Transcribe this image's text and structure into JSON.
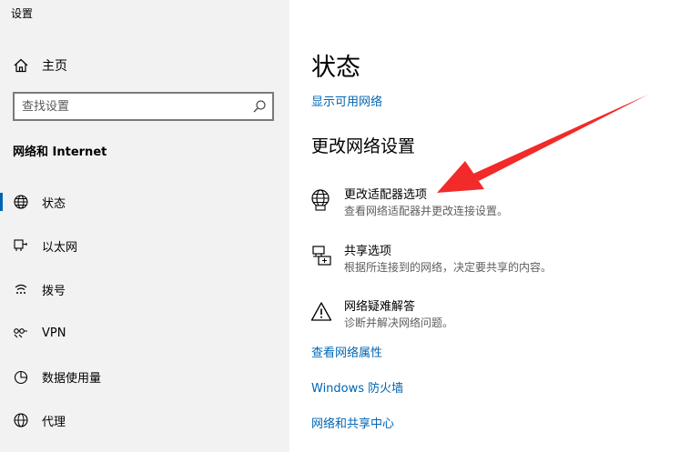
{
  "window": {
    "title": "设置"
  },
  "sidebar": {
    "home_label": "主页",
    "search_placeholder": "查找设置",
    "section_title": "网络和 Internet",
    "items": [
      {
        "label": "状态",
        "icon": "globe-icon",
        "selected": true
      },
      {
        "label": "以太网",
        "icon": "ethernet-icon"
      },
      {
        "label": "拨号",
        "icon": "dialup-icon"
      },
      {
        "label": "VPN",
        "icon": "vpn-icon"
      },
      {
        "label": "数据使用量",
        "icon": "data-usage-icon"
      },
      {
        "label": "代理",
        "icon": "proxy-globe-icon"
      }
    ]
  },
  "main": {
    "title": "状态",
    "show_networks_link": "显示可用网络",
    "change_heading": "更改网络设置",
    "options": [
      {
        "title": "更改适配器选项",
        "desc": "查看网络适配器并更改连接设置。",
        "icon": "adapter-globe-icon"
      },
      {
        "title": "共享选项",
        "desc": "根据所连接到的网络，决定要共享的内容。",
        "icon": "sharing-icon"
      },
      {
        "title": "网络疑难解答",
        "desc": "诊断并解决网络问题。",
        "icon": "warning-icon"
      }
    ],
    "links": [
      "查看网络属性",
      "Windows 防火墙",
      "网络和共享中心"
    ]
  },
  "colors": {
    "accent": "#0063b1",
    "link": "#0066b4",
    "annotation_arrow": "#f22a2a"
  }
}
